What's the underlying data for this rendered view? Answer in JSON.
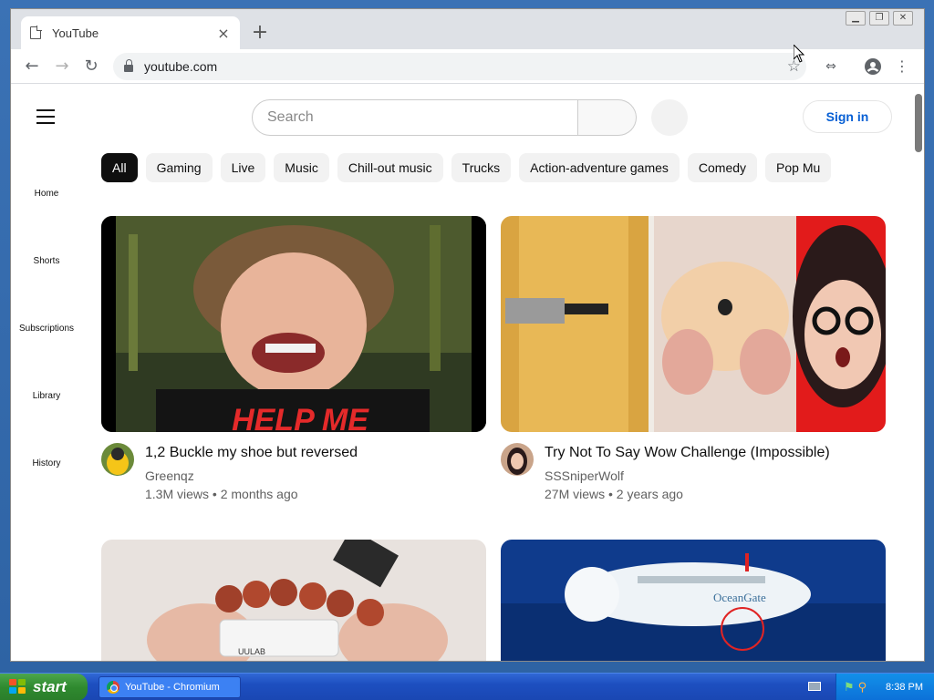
{
  "browser": {
    "tab_title": "YouTube",
    "tab_close": "×",
    "new_tab": "+",
    "url": "youtube.com",
    "window_controls": [
      "minimize",
      "maximize",
      "close"
    ]
  },
  "header": {
    "search_placeholder": "Search",
    "sign_in_label": "Sign in"
  },
  "sidebar": {
    "items": [
      {
        "label": "Home"
      },
      {
        "label": "Shorts"
      },
      {
        "label": "Subscriptions"
      },
      {
        "label": "Library"
      },
      {
        "label": "History"
      }
    ]
  },
  "chips": [
    "All",
    "Gaming",
    "Live",
    "Music",
    "Chill-out music",
    "Trucks",
    "Action-adventure games",
    "Comedy",
    "Pop Mu"
  ],
  "videos": [
    {
      "title": "1,2 Buckle my shoe but reversed",
      "channel": "Greenqz",
      "stats": "1.3M views • 2 months ago",
      "thumb_text": "HELP ME"
    },
    {
      "title": "Try Not To Say Wow Challenge (Impossible)",
      "channel": "SSSniperWolf",
      "stats": "27M views • 2 years ago",
      "thumb_text": ""
    },
    {
      "title": "",
      "channel": "",
      "stats": "",
      "thumb_text": "UULAB"
    },
    {
      "title": "",
      "channel": "",
      "stats": "",
      "thumb_text": "OceanGate"
    }
  ],
  "taskbar": {
    "start_label": "start",
    "app_label": "YouTube - Chromium",
    "clock": "8:38 PM"
  },
  "colors": {
    "chip_active_bg": "#0f0f0f",
    "signin_blue": "#065fd4",
    "taskbar_blue": "#1d4fc0",
    "start_green": "#2f8a2f"
  }
}
